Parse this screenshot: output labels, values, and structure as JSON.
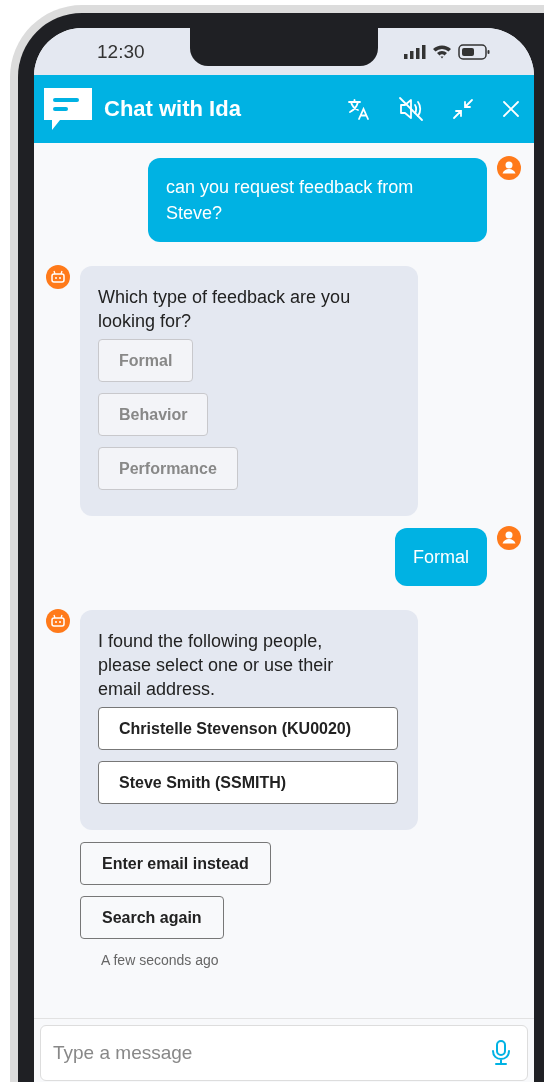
{
  "status_bar": {
    "time": "12:30"
  },
  "header": {
    "title": "Chat with Ida"
  },
  "messages": [
    {
      "kind": "user",
      "text": "can you request feedback from Steve?"
    },
    {
      "kind": "bot",
      "text": "Which type of feedback are you looking for?",
      "options": [
        {
          "label": "Formal",
          "disabled": true
        },
        {
          "label": "Behavior",
          "disabled": true
        },
        {
          "label": "Performance",
          "disabled": true
        }
      ]
    },
    {
      "kind": "user",
      "text": "Formal"
    },
    {
      "kind": "bot",
      "text": "I found the following people, please select one or use their email address.",
      "options": [
        {
          "label": "Christelle Stevenson (KU0020)",
          "disabled": false
        },
        {
          "label": "Steve Smith (SSMITH)",
          "disabled": false
        }
      ]
    }
  ],
  "actions": [
    "Enter email instead",
    "Search again"
  ],
  "timestamp": "A few seconds ago",
  "composer": {
    "placeholder": "Type a message"
  }
}
